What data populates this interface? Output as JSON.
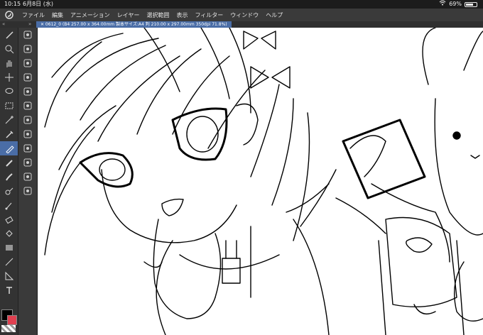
{
  "status": {
    "time": "10:15",
    "date": "6月8日 (水)",
    "battery": "69%",
    "battery_level": 0.69
  },
  "menu": {
    "items": [
      "ファイル",
      "編集",
      "アニメーション",
      "レイヤー",
      "選択範囲",
      "表示",
      "フィルター",
      "ウィンドウ",
      "ヘルプ"
    ]
  },
  "tab": {
    "title": "✕ 0612_0 (B4 257.00 x 364.00mm 製本サイズ:A4 判 210.00 x 297.00mm 350dpi 71.8%)"
  },
  "colors": {
    "accent": "#4a6da6",
    "main_color": "#000000",
    "sub_color": "#e04050"
  },
  "tools_main": [
    "sub-tool-icon",
    "magnifier-icon",
    "hand-icon",
    "move-icon",
    "lasso-icon",
    "select-icon",
    "wand-icon",
    "eyedropper-icon",
    "pen-icon",
    "pencil-icon",
    "brush-icon",
    "airbrush-icon",
    "blend-icon",
    "eraser-icon",
    "fill-icon",
    "gradient-icon",
    "line-icon",
    "ruler-icon",
    "text-icon"
  ],
  "tools_sub": [
    "navigator-icon",
    "sub-tool-a-icon",
    "sub-tool-b-icon",
    "sub-tool-c-icon",
    "sub-tool-d-icon",
    "color-wheel-icon",
    "layer-icon",
    "layer-property-icon",
    "material-icon",
    "history-icon",
    "auto-action-icon",
    "quick-access-icon"
  ]
}
